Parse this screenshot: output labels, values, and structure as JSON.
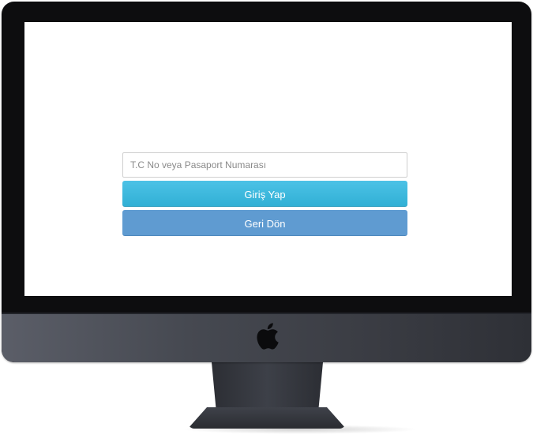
{
  "login": {
    "id_placeholder": "T.C No veya Pasaport Numarası",
    "id_value": "",
    "login_button_label": "Giriş Yap",
    "back_button_label": "Geri Dön"
  },
  "colors": {
    "login_button": "#31b0d5",
    "back_button": "#5f9bd1",
    "bezel": "#0d0d0f",
    "screen_background": "#ffffff"
  },
  "icons": {
    "monitor_logo": "apple-logo-icon"
  }
}
